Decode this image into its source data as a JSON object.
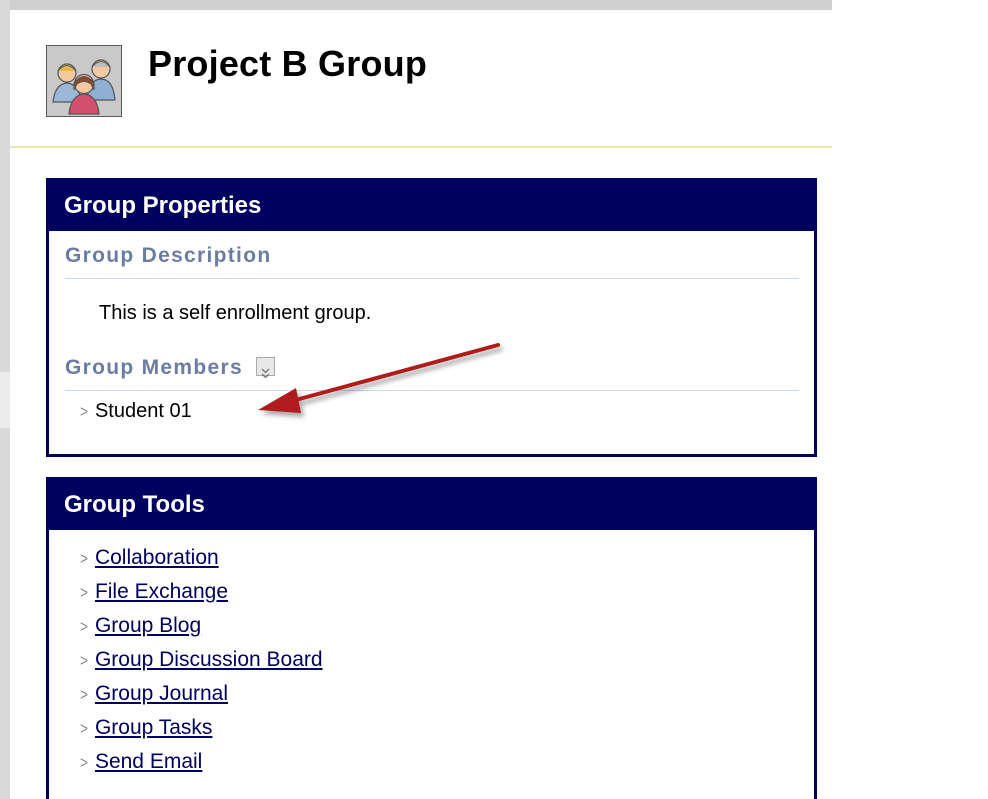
{
  "header": {
    "title": "Project B Group",
    "icon": "group-people-icon"
  },
  "group_properties": {
    "heading": "Group Properties",
    "description_label": "Group Description",
    "description_text": "This is a self enrollment group.",
    "members_label": "Group Members",
    "members": [
      "Student 01"
    ]
  },
  "group_tools": {
    "heading": "Group Tools",
    "tools": [
      "Collaboration",
      "File Exchange",
      "Group Blog",
      "Group Discussion Board",
      "Group Journal",
      "Group Tasks",
      "Send Email"
    ]
  },
  "colors": {
    "panel_header": "#00005e",
    "section_title": "#6b7ea2",
    "annotation_arrow": "#b01e1e"
  }
}
